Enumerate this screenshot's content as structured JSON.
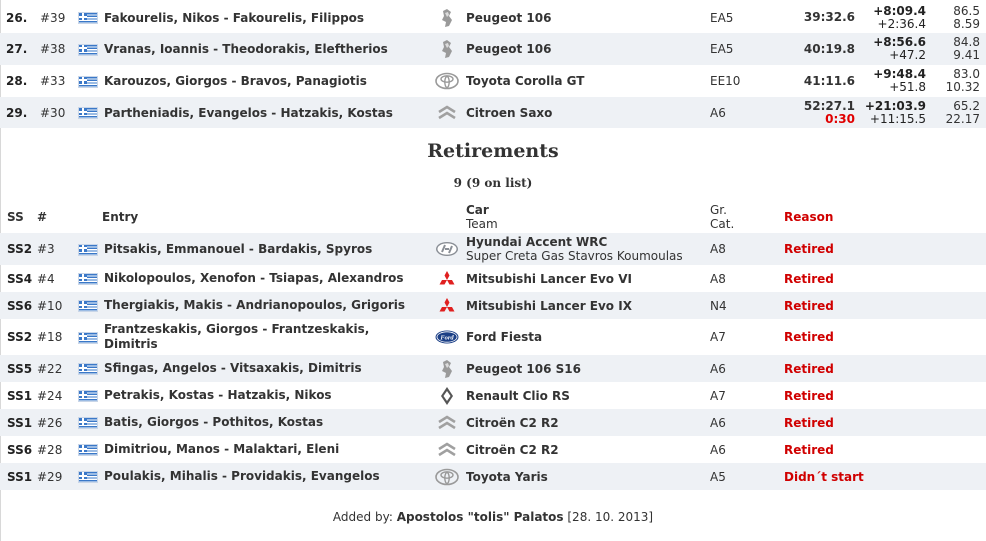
{
  "results": [
    {
      "pos": "26.",
      "num": "#39",
      "entry": "Fakourelis, Nikos - Fakourelis, Filippos",
      "make": "peugeot",
      "car": "Peugeot 106",
      "cat": "EA5",
      "time": "39:32.6",
      "penalty": "",
      "diff1": "+8:09.4",
      "diff2": "+2:36.4",
      "speed1": "86.5",
      "speed2": "8.59"
    },
    {
      "pos": "27.",
      "num": "#38",
      "entry": "Vranas, Ioannis - Theodorakis, Eleftherios",
      "make": "peugeot",
      "car": "Peugeot 106",
      "cat": "EA5",
      "time": "40:19.8",
      "penalty": "",
      "diff1": "+8:56.6",
      "diff2": "+47.2",
      "speed1": "84.8",
      "speed2": "9.41"
    },
    {
      "pos": "28.",
      "num": "#33",
      "entry": "Karouzos, Giorgos - Bravos, Panagiotis",
      "make": "toyota",
      "car": "Toyota Corolla GT",
      "cat": "EE10",
      "time": "41:11.6",
      "penalty": "",
      "diff1": "+9:48.4",
      "diff2": "+51.8",
      "speed1": "83.0",
      "speed2": "10.32"
    },
    {
      "pos": "29.",
      "num": "#30",
      "entry": "Partheniadis, Evangelos - Hatzakis, Kostas",
      "make": "citroen",
      "car": "Citroen Saxo",
      "cat": "A6",
      "time": "52:27.1",
      "penalty": "0:30",
      "diff1": "+21:03.9",
      "diff2": "+11:15.5",
      "speed1": "65.2",
      "speed2": "22.17"
    }
  ],
  "retirements": {
    "title": "Retirements",
    "count": "9 (9 on list)",
    "headers": {
      "ss": "SS",
      "num": "#",
      "entry": "Entry",
      "car": "Car",
      "team": "Team",
      "gr": "Gr.",
      "cat": "Cat.",
      "reason": "Reason"
    },
    "rows": [
      {
        "ss": "SS2",
        "num": "#3",
        "entry": "Pitsakis, Emmanouel - Bardakis, Spyros",
        "entry2": "",
        "make": "hyundai",
        "car": "Hyundai Accent WRC",
        "team": "Super Creta Gas Stavros Koumoulas",
        "cat": "A8",
        "reason": "Retired"
      },
      {
        "ss": "SS4",
        "num": "#4",
        "entry": "Nikolopoulos, Xenofon - Tsiapas, Alexandros",
        "entry2": "",
        "make": "mitsubishi",
        "car": "Mitsubishi Lancer Evo VI",
        "team": "",
        "cat": "A8",
        "reason": "Retired"
      },
      {
        "ss": "SS6",
        "num": "#10",
        "entry": "Thergiakis, Makis - Andrianopoulos, Grigoris",
        "entry2": "",
        "make": "mitsubishi",
        "car": "Mitsubishi Lancer Evo IX",
        "team": "",
        "cat": "N4",
        "reason": "Retired"
      },
      {
        "ss": "SS2",
        "num": "#18",
        "entry": "Frantzeskakis, Giorgos - Frantzeskakis,",
        "entry2": "Dimitris",
        "make": "ford",
        "car": "Ford Fiesta",
        "team": "",
        "cat": "A7",
        "reason": "Retired"
      },
      {
        "ss": "SS5",
        "num": "#22",
        "entry": "Sfingas, Angelos - Vitsaxakis, Dimitris",
        "entry2": "",
        "make": "peugeot",
        "car": "Peugeot 106 S16",
        "team": "",
        "cat": "A6",
        "reason": "Retired"
      },
      {
        "ss": "SS1",
        "num": "#24",
        "entry": "Petrakis, Kostas - Hatzakis, Nikos",
        "entry2": "",
        "make": "renault",
        "car": "Renault Clio RS",
        "team": "",
        "cat": "A7",
        "reason": "Retired"
      },
      {
        "ss": "SS1",
        "num": "#26",
        "entry": "Batis, Giorgos - Pothitos, Kostas",
        "entry2": "",
        "make": "citroen",
        "car": "Citroën C2 R2",
        "team": "",
        "cat": "A6",
        "reason": "Retired"
      },
      {
        "ss": "SS6",
        "num": "#28",
        "entry": "Dimitriou, Manos - Malaktari, Eleni",
        "entry2": "",
        "make": "citroen",
        "car": "Citroën C2 R2",
        "team": "",
        "cat": "A6",
        "reason": "Retired"
      },
      {
        "ss": "SS1",
        "num": "#29",
        "entry": "Poulakis, Mihalis - Providakis, Evangelos",
        "entry2": "",
        "make": "toyota",
        "car": "Toyota Yaris",
        "team": "",
        "cat": "A5",
        "reason": "Didn´t start"
      }
    ]
  },
  "footer": {
    "prefix": "Added by:",
    "author": "Apostolos \"tolis\" Palatos",
    "date": "[28. 10. 2013]"
  }
}
